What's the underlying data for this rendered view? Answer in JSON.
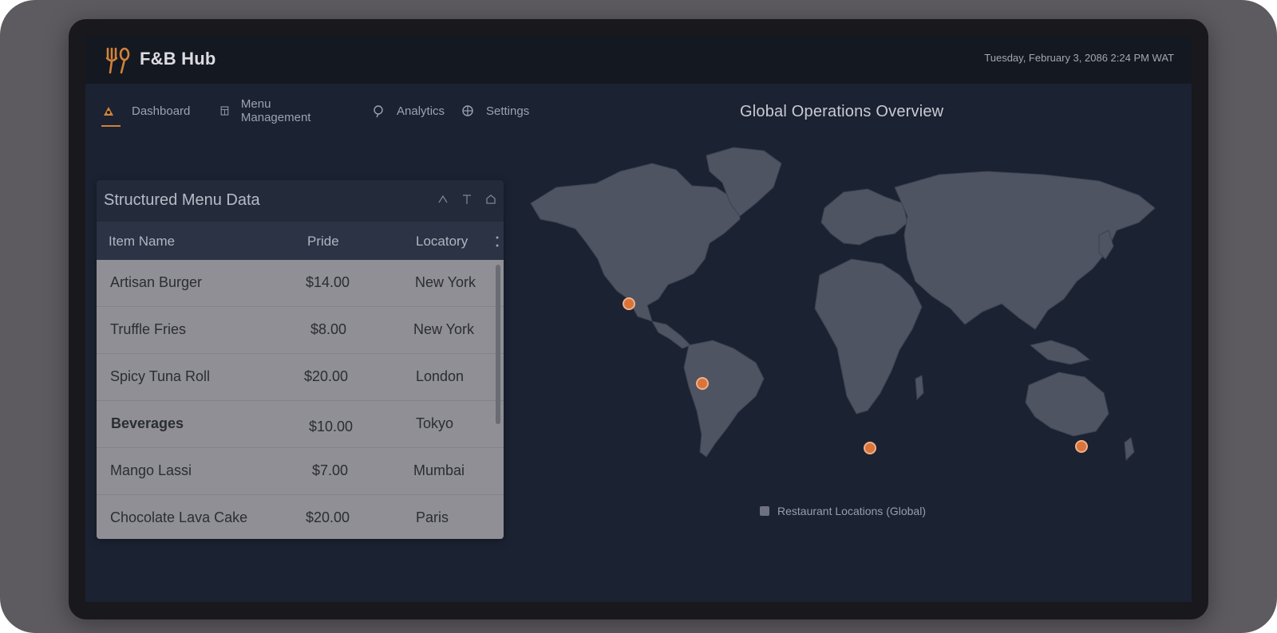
{
  "header": {
    "app_title": "F&B Hub",
    "datetime": "Tuesday, February 3, 2086 2:24 PM WAT"
  },
  "nav": {
    "items": [
      {
        "label": "Dashboard",
        "icon": "home-icon",
        "active": true
      },
      {
        "label": "Menu Management",
        "icon": "menu-book-icon",
        "active": false
      },
      {
        "label": "Analytics",
        "icon": "analytics-icon",
        "active": false
      },
      {
        "label": "Settings",
        "icon": "gear-icon",
        "active": false
      }
    ]
  },
  "overview": {
    "title": "Global Operations Overview",
    "legend_label": "Restaurant Locations (Global)",
    "marker_color": "#d9743a"
  },
  "menu_panel": {
    "title": "Structured Menu Data",
    "columns": [
      "Item Name",
      "Pride",
      "Locatory"
    ],
    "rows": [
      {
        "name": "Artisan Burger",
        "price": "$14.00",
        "location": "New York"
      },
      {
        "name": "Truffle Fries",
        "price": "$8.00",
        "location": "New York"
      },
      {
        "name": "Spicy Tuna Roll",
        "price": "$20.00",
        "location": "London"
      },
      {
        "name": "Beverages",
        "price": "$10.00",
        "location": "Tokyo"
      },
      {
        "name": "Mango Lassi",
        "price": "$7.00",
        "location": "Mumbai"
      },
      {
        "name": "Chocolate Lava Cake",
        "price": "$20.00",
        "location": "Paris"
      }
    ]
  },
  "colors": {
    "accent": "#d0833a",
    "topbar": "#141821",
    "screen": "#1b2232"
  }
}
